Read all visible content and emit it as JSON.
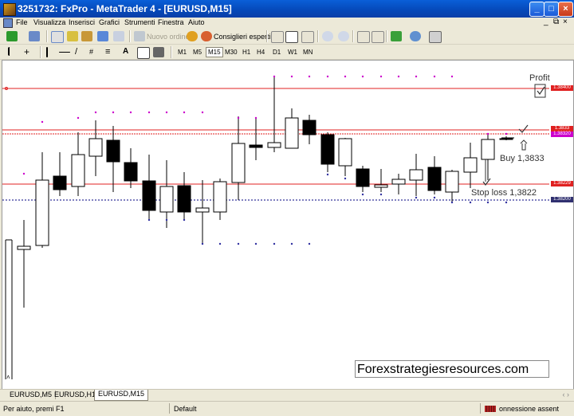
{
  "window": {
    "title": "3251732: FxPro - MetaTrader 4 - [EURUSD,M15]"
  },
  "menu": [
    "File",
    "Visualizza",
    "Inserisci",
    "Grafici",
    "Strumenti",
    "Finestra",
    "Aiuto"
  ],
  "menu_right": {
    "minimize": "_",
    "restore": "⧉",
    "close": "×"
  },
  "toolbar": {
    "new_order": "Nuovo ordine",
    "expert_advisors": "Consiglieri esperti",
    "text_tool": "A",
    "timeframes": [
      "M1",
      "M5",
      "M15",
      "M30",
      "H1",
      "H4",
      "D1",
      "W1",
      "MN"
    ],
    "active_timeframe": "M15"
  },
  "chart": {
    "price_labels": {
      "profit": "1.38400",
      "upper1": "1.3833",
      "upper2": "1.38320",
      "stop": "1.38229",
      "lower": "1.38200"
    },
    "annotations": {
      "profit": "Profit",
      "buy": "Buy 1,3833",
      "stop_loss": "Stop loss 1,3822"
    },
    "watermark": "Forexstrategiesresources.com",
    "colors": {
      "profit_line": "#e02020",
      "stop_line": "#e02020",
      "grid_dots": "#000080",
      "candle_bull": "#ffffff",
      "candle_bear": "#000000",
      "dot_magenta": "#cc00cc",
      "dot_blue": "#3030a0"
    }
  },
  "tabs": [
    "EURUSD,M5",
    "EURUSD,H1",
    "EURUSD,M15"
  ],
  "active_tab": "EURUSD,M15",
  "status": {
    "help": "Per aiuto, premi F1",
    "profile": "Default",
    "connection": "onnessione assent"
  }
}
